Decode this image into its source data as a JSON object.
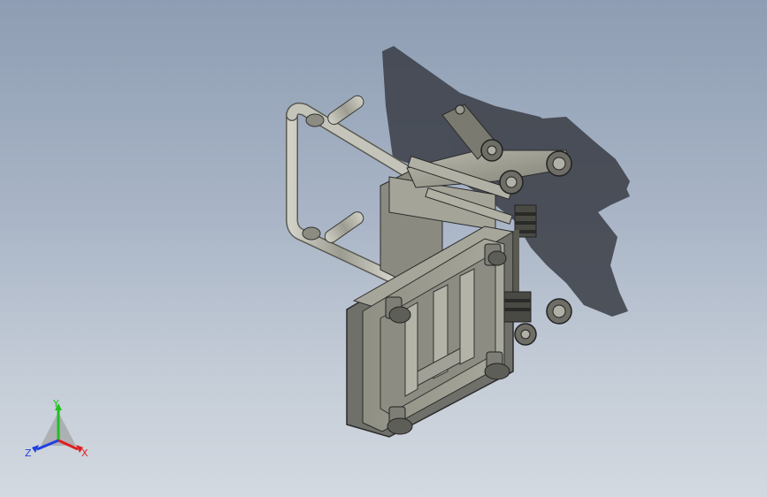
{
  "viewport": {
    "background_top": "#8e9db3",
    "background_bottom": "#d3d9e0"
  },
  "model": {
    "body_color": "#9a9a8e",
    "shadow_color": "#3a3d45",
    "edge_color": "#2b2b2b"
  },
  "triad": {
    "x_label": "X",
    "y_label": "Y",
    "z_label": "Z",
    "x_color": "#e02020",
    "y_color": "#20c020",
    "z_color": "#2040e0"
  }
}
